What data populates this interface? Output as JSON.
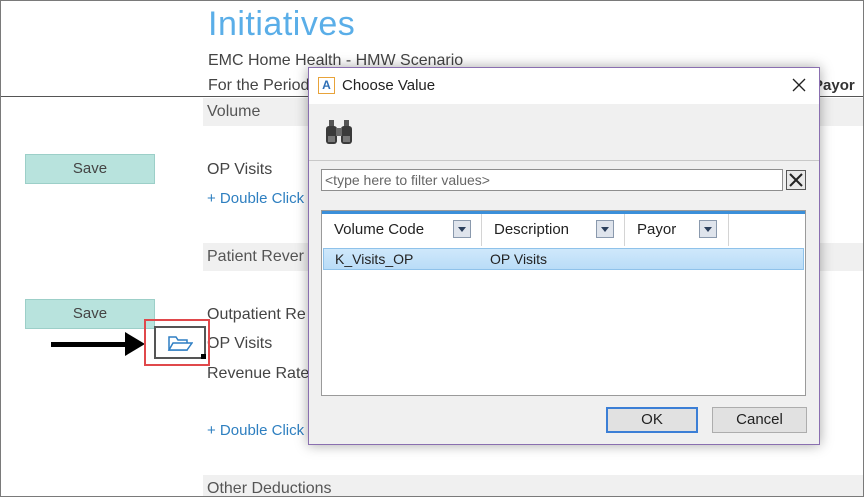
{
  "page": {
    "title": "Initiatives",
    "subtitle": "EMC Home Health - HMW Scenario",
    "period": "For the Period",
    "payor_header": "Payor"
  },
  "sections": {
    "volume": "Volume",
    "op_visits": "OP Visits",
    "add_link_1": "+ Double Click",
    "patient_revenue": "Patient Rever",
    "outpatient": "Outpatient Re",
    "op_visits_2": "OP Visits",
    "revenue_rate": "Revenue Rate",
    "add_link_2": "+ Double Click",
    "other_deductions": "Other Deductions"
  },
  "buttons": {
    "save_1": "Save",
    "save_2": "Save"
  },
  "dialog": {
    "title": "Choose Value",
    "logo_letter": "A",
    "filter_placeholder": "<type here to filter values>",
    "filter_value": "",
    "columns": [
      "Volume Code",
      "Description",
      "Payor"
    ],
    "rows": [
      {
        "volume_code": "K_Visits_OP",
        "description": "OP Visits",
        "payor": ""
      }
    ],
    "ok_label": "OK",
    "cancel_label": "Cancel"
  },
  "colors": {
    "title_blue": "#5aaee8",
    "save_teal": "#b8e3dd",
    "highlight_red": "#e0484b",
    "dialog_border": "#8a6fb0"
  },
  "icons": [
    "folder-open-icon",
    "binoculars-icon",
    "close-icon",
    "dropdown-arrow-icon",
    "app-logo-icon"
  ]
}
